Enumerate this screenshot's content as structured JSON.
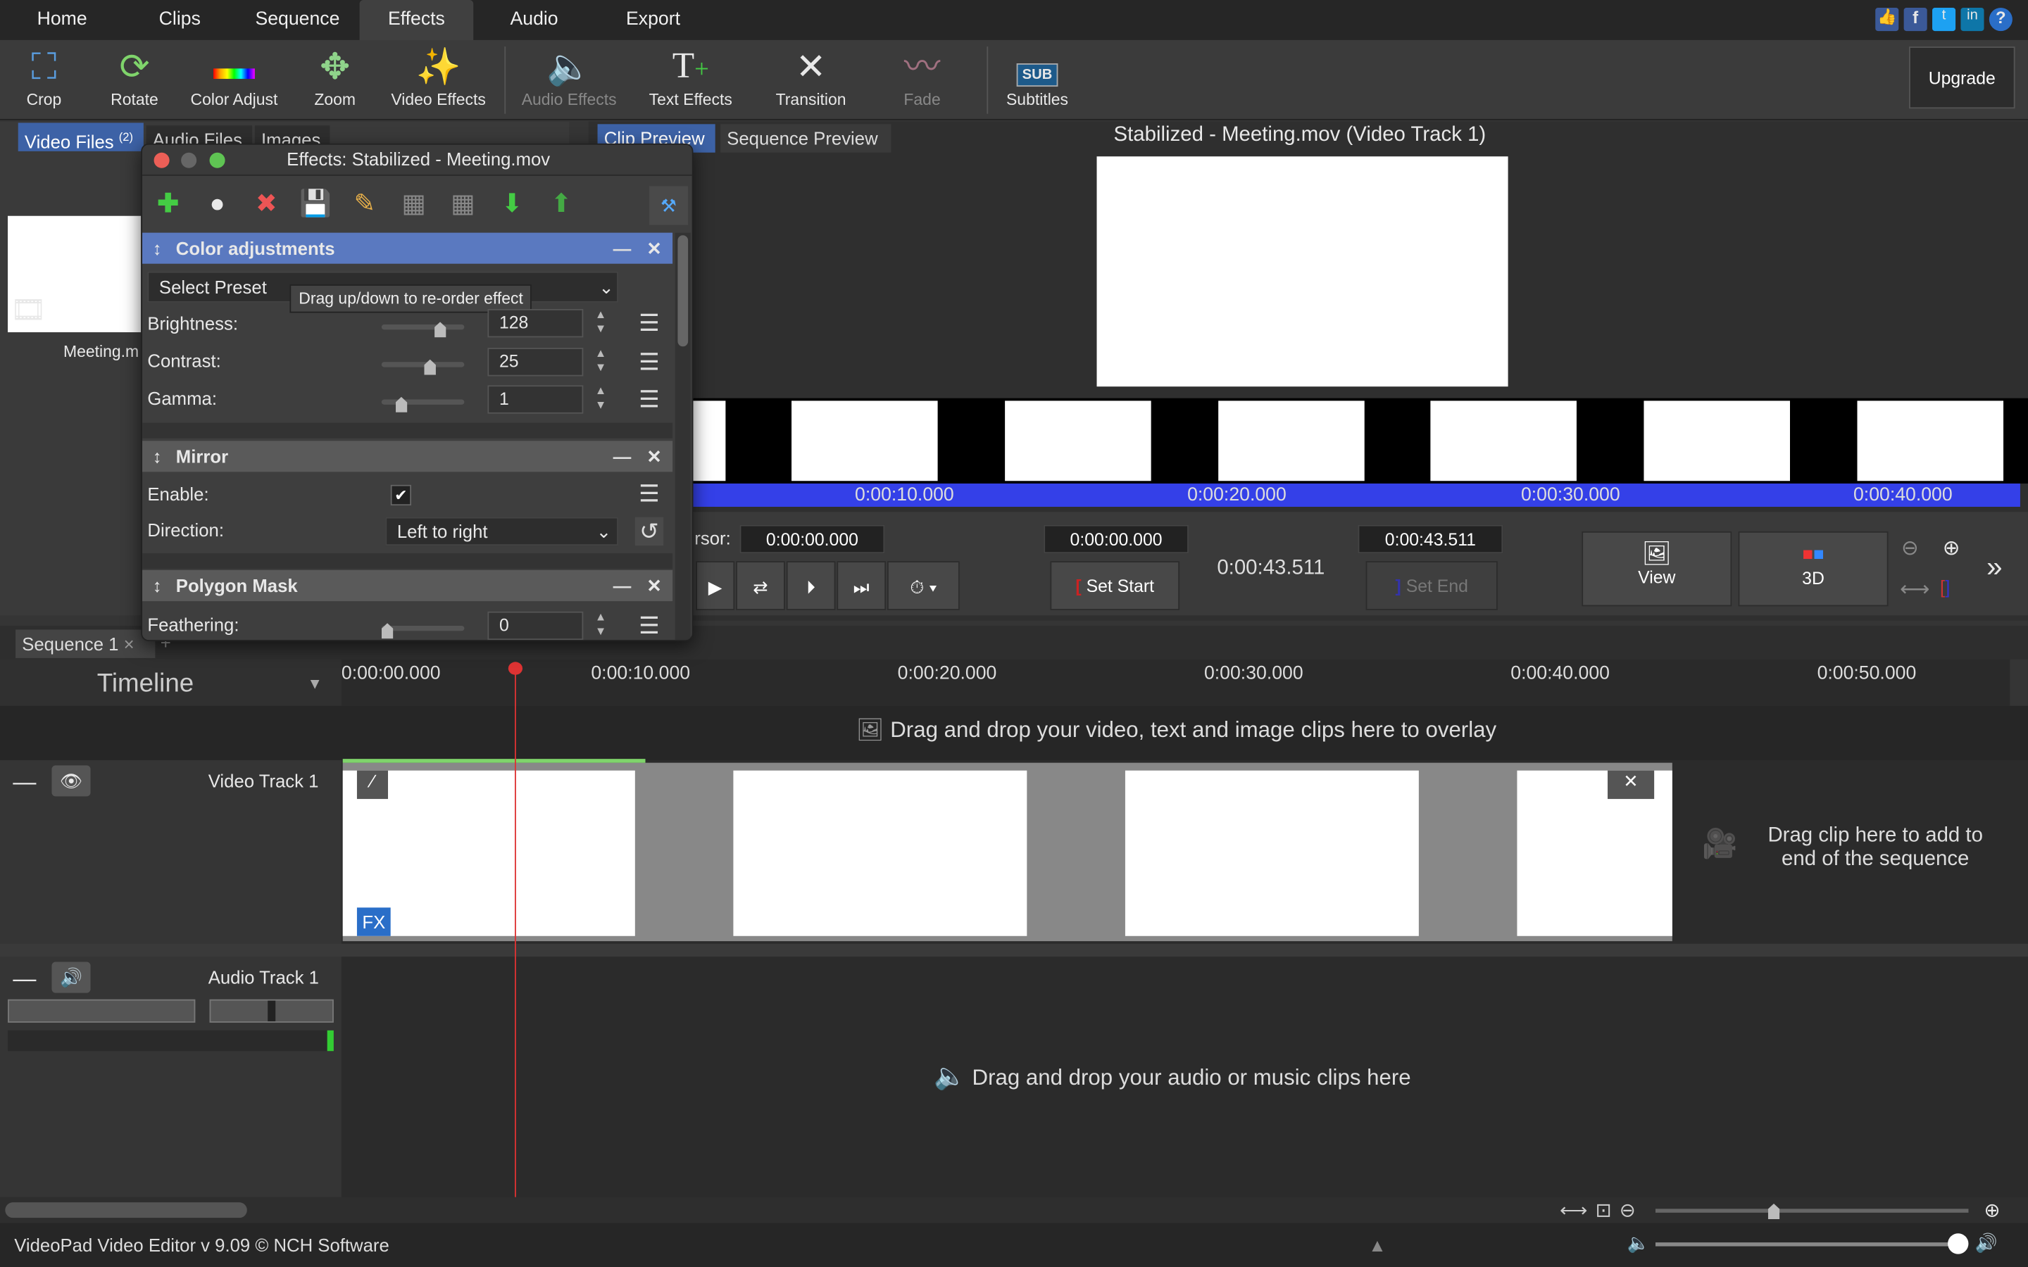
{
  "menu": {
    "tabs": [
      "Home",
      "Clips",
      "Sequence",
      "Effects",
      "Audio",
      "Export"
    ],
    "active": "Effects"
  },
  "toolbar": {
    "items": [
      {
        "label": "Crop",
        "icon": "crop-icon"
      },
      {
        "label": "Rotate",
        "icon": "rotate-icon"
      },
      {
        "label": "Color Adjust",
        "icon": "color-adjust-icon"
      },
      {
        "label": "Zoom",
        "icon": "zoom-icon"
      },
      {
        "label": "Video Effects",
        "icon": "video-effects-icon"
      },
      {
        "label": "Audio Effects",
        "icon": "audio-effects-icon",
        "disabled": true
      },
      {
        "label": "Text Effects",
        "icon": "text-effects-icon"
      },
      {
        "label": "Transition",
        "icon": "transition-icon"
      },
      {
        "label": "Fade",
        "icon": "fade-icon",
        "disabled": true
      },
      {
        "label": "Subtitles",
        "icon": "subtitles-icon"
      }
    ],
    "upgrade": "Upgrade"
  },
  "media": {
    "tabs": [
      "Video Files",
      "Audio Files",
      "Images"
    ],
    "video_count": "(2)",
    "item": "Meeting.mov",
    "item_visible": "Meeting.m"
  },
  "preview": {
    "tabs": [
      "Clip Preview",
      "Sequence Preview"
    ],
    "title": "Stabilized - Meeting.mov (Video Track 1)",
    "ruler": [
      "0:00:10.000",
      "0:00:20.000",
      "0:00:30.000",
      "0:00:40.000"
    ],
    "cursor_label": "rsor:",
    "cursor": "0:00:00.000",
    "start": "0:00:00.000",
    "duration": "0:00:43.511",
    "end": "0:00:43.511",
    "set_start": "Set Start",
    "set_end": "Set End",
    "view": "View",
    "three_d": "3D"
  },
  "effects_dialog": {
    "title": "Effects: Stabilized - Meeting.mov",
    "tooltip": "Drag up/down to re-order effect",
    "color": {
      "title": "Color adjustments",
      "preset": "Select Preset",
      "brightness_label": "Brightness:",
      "brightness": "128",
      "contrast_label": "Contrast:",
      "contrast": "25",
      "gamma_label": "Gamma:",
      "gamma": "1",
      "levels": {
        "brightness": 0.68,
        "contrast": 0.55,
        "gamma": 0.18
      }
    },
    "mirror": {
      "title": "Mirror",
      "enable_label": "Enable:",
      "enabled": true,
      "direction_label": "Direction:",
      "direction": "Left to right"
    },
    "polygon": {
      "title": "Polygon Mask",
      "feathering_label": "Feathering:",
      "feathering": "0",
      "level": 0.0
    }
  },
  "sequence": {
    "tab": "Sequence 1",
    "timeline_label": "Timeline",
    "ruler": [
      "0:00:00.000",
      "0:00:10.000",
      "0:00:20.000",
      "0:00:30.000",
      "0:00:40.000",
      "0:00:50.000"
    ],
    "overlay_hint": "Drag and drop your video, text and image clips here to overlay",
    "video_track": "Video Track 1",
    "end_hint": "Drag clip here to add to end of the sequence",
    "audio_track": "Audio Track 1",
    "audio_hint": "Drag and drop your audio or music clips here",
    "fx": "FX"
  },
  "status": {
    "text": "VideoPad Video Editor v 9.09 © NCH Software"
  }
}
